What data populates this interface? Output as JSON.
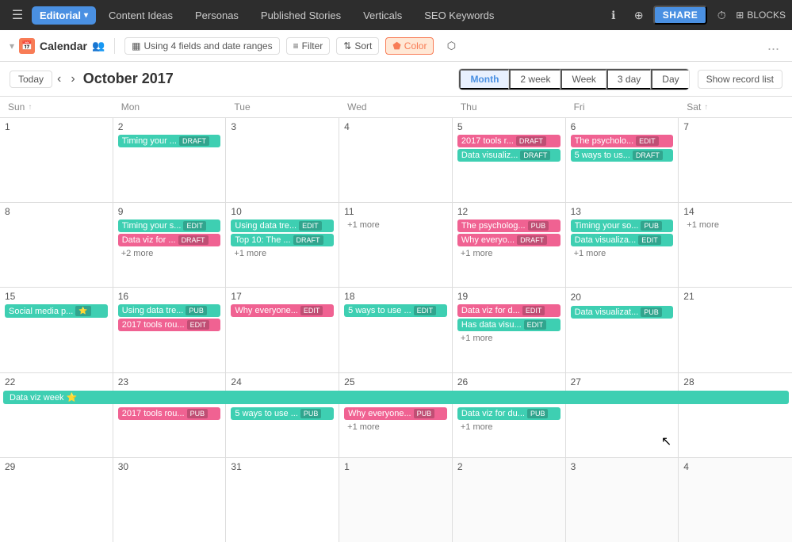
{
  "topnav": {
    "hamburger": "☰",
    "app_name": "Editorial",
    "caret": "▾",
    "tabs": [
      {
        "label": "Content Ideas",
        "active": false
      },
      {
        "label": "Personas",
        "active": false
      },
      {
        "label": "Published Stories",
        "active": false
      },
      {
        "label": "Verticals",
        "active": false
      },
      {
        "label": "SEO Keywords",
        "active": false
      }
    ],
    "share_label": "SHARE",
    "blocks_label": "BLOCKS"
  },
  "toolbar": {
    "calendar_label": "Calendar",
    "fields_label": "Using 4 fields and date ranges",
    "filter_label": "Filter",
    "sort_label": "Sort",
    "color_label": "Color",
    "more": "..."
  },
  "calheader": {
    "today_label": "Today",
    "prev": "‹",
    "next": "›",
    "month_title": "October 2017",
    "view_buttons": [
      "Month",
      "2 week",
      "Week",
      "3 day",
      "Day"
    ],
    "active_view": "Month",
    "show_record_list": "Show record list"
  },
  "dow": [
    "Sun",
    "Mon",
    "Tue",
    "Wed",
    "Thu",
    "Fri",
    "Sat"
  ],
  "weeks": [
    {
      "days": [
        {
          "num": "1",
          "events": [],
          "other": false
        },
        {
          "num": "2",
          "events": [
            {
              "text": "Timing your ... ",
              "badge": "DRAFT",
              "color": "teal"
            }
          ],
          "other": false
        },
        {
          "num": "3",
          "events": [],
          "other": false
        },
        {
          "num": "4",
          "events": [],
          "other": false
        },
        {
          "num": "5",
          "events": [
            {
              "text": "2017 tools r... ",
              "badge": "DRAFT",
              "color": "pink"
            },
            {
              "text": "Data visualiz... ",
              "badge": "DRAFT",
              "color": "teal"
            }
          ],
          "other": false
        },
        {
          "num": "6",
          "events": [
            {
              "text": "The psycholo... ",
              "badge": "EDIT",
              "color": "pink"
            },
            {
              "text": "5 ways to us... ",
              "badge": "DRAFT",
              "color": "teal"
            }
          ],
          "other": false
        },
        {
          "num": "7",
          "events": [],
          "other": false
        }
      ]
    },
    {
      "days": [
        {
          "num": "8",
          "events": [],
          "other": false
        },
        {
          "num": "9",
          "events": [
            {
              "text": "Timing your s... ",
              "badge": "EDIT",
              "color": "teal"
            },
            {
              "text": "Data viz for ... ",
              "badge": "DRAFT",
              "color": "pink"
            }
          ],
          "more": "+2 more",
          "other": false
        },
        {
          "num": "10",
          "events": [
            {
              "text": "Using data tre... ",
              "badge": "EDIT",
              "color": "teal"
            },
            {
              "text": "Top 10: The ... ",
              "badge": "DRAFT",
              "color": "teal"
            }
          ],
          "more": "+1 more",
          "other": false
        },
        {
          "num": "11",
          "events": [],
          "more": "+1 more",
          "other": false
        },
        {
          "num": "12",
          "events": [
            {
              "text": "The psycholog... ",
              "badge": "PUB",
              "color": "pink"
            },
            {
              "text": "Why everyо... ",
              "badge": "DRAFT",
              "color": "pink"
            }
          ],
          "more": "+1 more",
          "other": false
        },
        {
          "num": "13",
          "events": [
            {
              "text": "Timing your so... ",
              "badge": "PUB",
              "color": "teal"
            },
            {
              "text": "Data visualiza... ",
              "badge": "EDIT",
              "color": "teal"
            }
          ],
          "more": "+1 more",
          "other": false
        },
        {
          "num": "14",
          "events": [],
          "more": "+1 more",
          "other": false
        }
      ]
    },
    {
      "days": [
        {
          "num": "15",
          "events": [
            {
              "text": "Social media p... ",
              "badge": "⭐",
              "color": "teal",
              "star": true
            }
          ],
          "other": false
        },
        {
          "num": "16",
          "events": [
            {
              "text": "Using data tre... ",
              "badge": "PUB",
              "color": "teal"
            },
            {
              "text": "2017 tools rou... ",
              "badge": "EDIT",
              "color": "pink"
            }
          ],
          "other": false
        },
        {
          "num": "17",
          "events": [
            {
              "text": "Why everyone... ",
              "badge": "EDIT",
              "color": "pink"
            }
          ],
          "other": false
        },
        {
          "num": "18",
          "events": [
            {
              "text": "5 ways to use ... ",
              "badge": "EDIT",
              "color": "teal"
            }
          ],
          "other": false
        },
        {
          "num": "19",
          "events": [
            {
              "text": "Data viz for d... ",
              "badge": "EDIT",
              "color": "pink"
            },
            {
              "text": "Has data visu... ",
              "badge": "EDIT",
              "color": "teal"
            }
          ],
          "more": "+1 more",
          "other": false
        },
        {
          "num": "20",
          "events": [
            {
              "text": "Data visualizat... ",
              "badge": "PUB",
              "color": "teal"
            }
          ],
          "addicon": true,
          "other": false
        },
        {
          "num": "21",
          "events": [],
          "other": false
        }
      ]
    },
    {
      "span_event": {
        "text": "Data viz week ⭐",
        "start": 0,
        "end": 6
      },
      "days": [
        {
          "num": "22",
          "events": [],
          "other": false
        },
        {
          "num": "23",
          "events": [
            {
              "text": "2017 tools rou... ",
              "badge": "PUB",
              "color": "pink"
            }
          ],
          "other": false
        },
        {
          "num": "24",
          "events": [
            {
              "text": "5 ways to use ... ",
              "badge": "PUB",
              "color": "teal"
            }
          ],
          "other": false
        },
        {
          "num": "25",
          "events": [
            {
              "text": "Why everyone... ",
              "badge": "PUB",
              "color": "pink"
            }
          ],
          "more": "+1 more",
          "other": false
        },
        {
          "num": "26",
          "events": [
            {
              "text": "Data viz for du... ",
              "badge": "PUB",
              "color": "teal"
            }
          ],
          "more": "+1 more",
          "other": false
        },
        {
          "num": "27",
          "events": [],
          "cursor": true,
          "other": false
        },
        {
          "num": "28",
          "events": [],
          "other": false
        }
      ]
    },
    {
      "days": [
        {
          "num": "29",
          "events": [],
          "other": false
        },
        {
          "num": "30",
          "events": [],
          "other": false
        },
        {
          "num": "31",
          "events": [],
          "other": false
        },
        {
          "num": "1",
          "events": [],
          "other": true
        },
        {
          "num": "2",
          "events": [],
          "other": true
        },
        {
          "num": "3",
          "events": [],
          "other": true
        },
        {
          "num": "4",
          "events": [],
          "other": true
        }
      ]
    }
  ]
}
